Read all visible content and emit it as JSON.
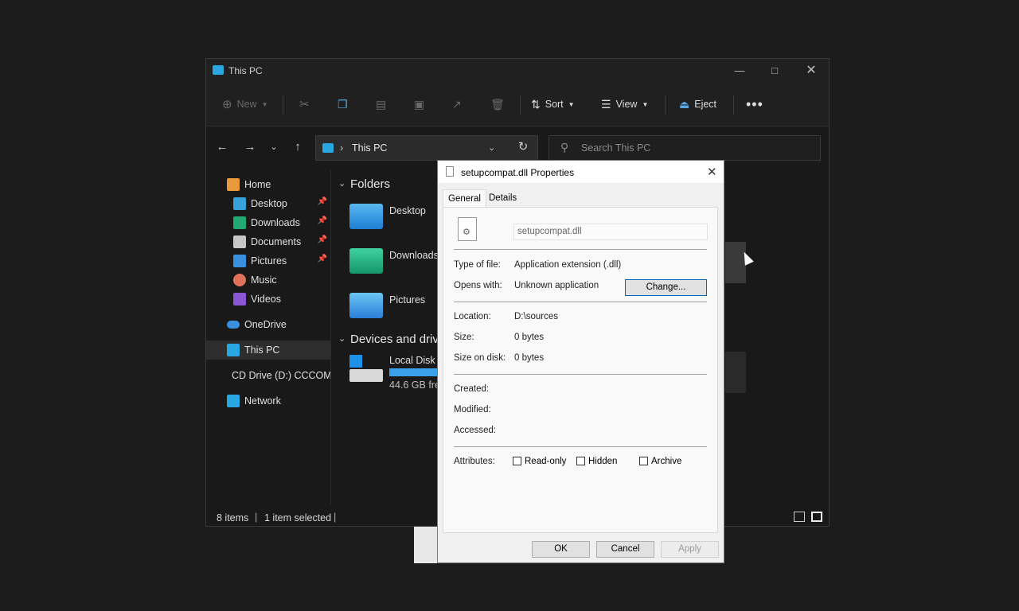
{
  "explorer": {
    "title": "This PC",
    "toolbar": {
      "new": "New",
      "sort": "Sort",
      "view": "View",
      "eject": "Eject"
    },
    "address": {
      "path": "This PC"
    },
    "search": {
      "placeholder": "Search This PC"
    },
    "sidebar": {
      "home": "Home",
      "quick": [
        {
          "label": "Desktop"
        },
        {
          "label": "Downloads"
        },
        {
          "label": "Documents"
        },
        {
          "label": "Pictures"
        },
        {
          "label": "Music"
        },
        {
          "label": "Videos"
        }
      ],
      "onedrive": "OneDrive",
      "thispc": "This PC",
      "cddrive": "CD Drive (D:) CCCOMA_X64FRE_EN-US_DV9",
      "network": "Network"
    },
    "main": {
      "folders_header": "Folders",
      "folders": [
        {
          "label": "Desktop"
        },
        {
          "label": "Downloads"
        },
        {
          "label": "Pictures"
        }
      ],
      "devices_header": "Devices and drives",
      "disk": {
        "label": "Local Disk (C:)",
        "free": "44.6 GB free"
      }
    },
    "status": {
      "items": "8 items",
      "selected": "1 item selected"
    }
  },
  "dialog": {
    "title": "setupcompat.dll Properties",
    "tabs": {
      "general": "General",
      "details": "Details"
    },
    "filename": "setupcompat.dll",
    "type_label": "Type of file:",
    "type_value": "Application extension (.dll)",
    "opens_label": "Opens with:",
    "opens_value": "Unknown application",
    "change_button": "Change...",
    "location_label": "Location:",
    "location_value": "D:\\sources",
    "size_label": "Size:",
    "size_value": "0 bytes",
    "sizeondisk_label": "Size on disk:",
    "sizeondisk_value": "0 bytes",
    "created_label": "Created:",
    "modified_label": "Modified:",
    "accessed_label": "Accessed:",
    "attributes_label": "Attributes:",
    "readonly": "Read-only",
    "hidden": "Hidden",
    "archive": "Archive",
    "ok": "OK",
    "cancel": "Cancel",
    "apply": "Apply"
  }
}
